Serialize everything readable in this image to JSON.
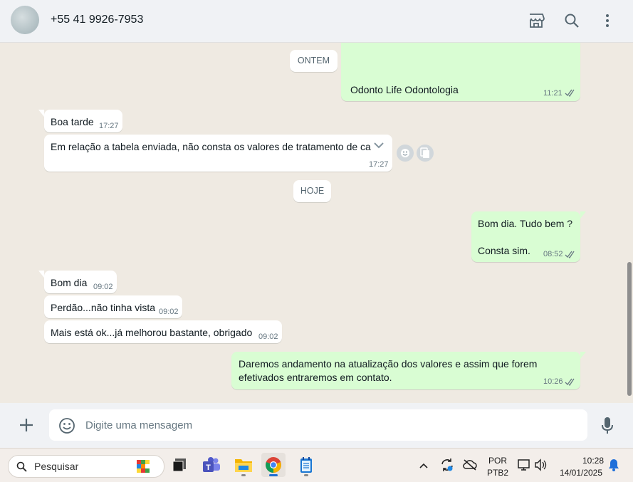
{
  "header": {
    "contact_name": "+55 41 9926-7953",
    "icons": [
      "avatar",
      "store-icon",
      "search-icon",
      "more-vertical-icon"
    ]
  },
  "chat": {
    "date_ontem": "ONTEM",
    "date_hoje": "HOJE",
    "messages": [
      {
        "dir": "out",
        "text": "Odonto Life Odontologia",
        "time": "11:21",
        "status": "read"
      },
      {
        "dir": "in",
        "text": "Boa tarde",
        "time": "17:27"
      },
      {
        "dir": "in",
        "text": "Em relação a tabela enviada, não consta os valores de tratamento de ca",
        "time": "17:27"
      },
      {
        "dir": "out",
        "text": "Bom dia. Tudo bem ?",
        "text2": "Consta sim.",
        "time": "08:52",
        "status": "read"
      },
      {
        "dir": "in",
        "text": "Bom dia",
        "time": "09:02"
      },
      {
        "dir": "in",
        "text": "Perdão...não tinha vista",
        "time": "09:02"
      },
      {
        "dir": "in",
        "text": "Mais está ok...já melhorou bastante, obrigado",
        "time": "09:02"
      },
      {
        "dir": "out",
        "text": "Daremos andamento na atualização dos valores e assim que forem",
        "text2": "efetivados entraremos em contato.",
        "time": "10:26",
        "status": "read"
      }
    ]
  },
  "composer": {
    "placeholder": "Digite uma mensagem"
  },
  "taskbar": {
    "search_label": "Pesquisar",
    "lang_line1": "POR",
    "lang_line2": "PTB2",
    "clock_time": "10:28",
    "clock_date": "14/01/2025"
  },
  "colors": {
    "outgoing_bubble": "#d9fdd3",
    "incoming_bubble": "#ffffff",
    "chat_background": "#efeae2",
    "read_tick": "#53bdeb"
  }
}
